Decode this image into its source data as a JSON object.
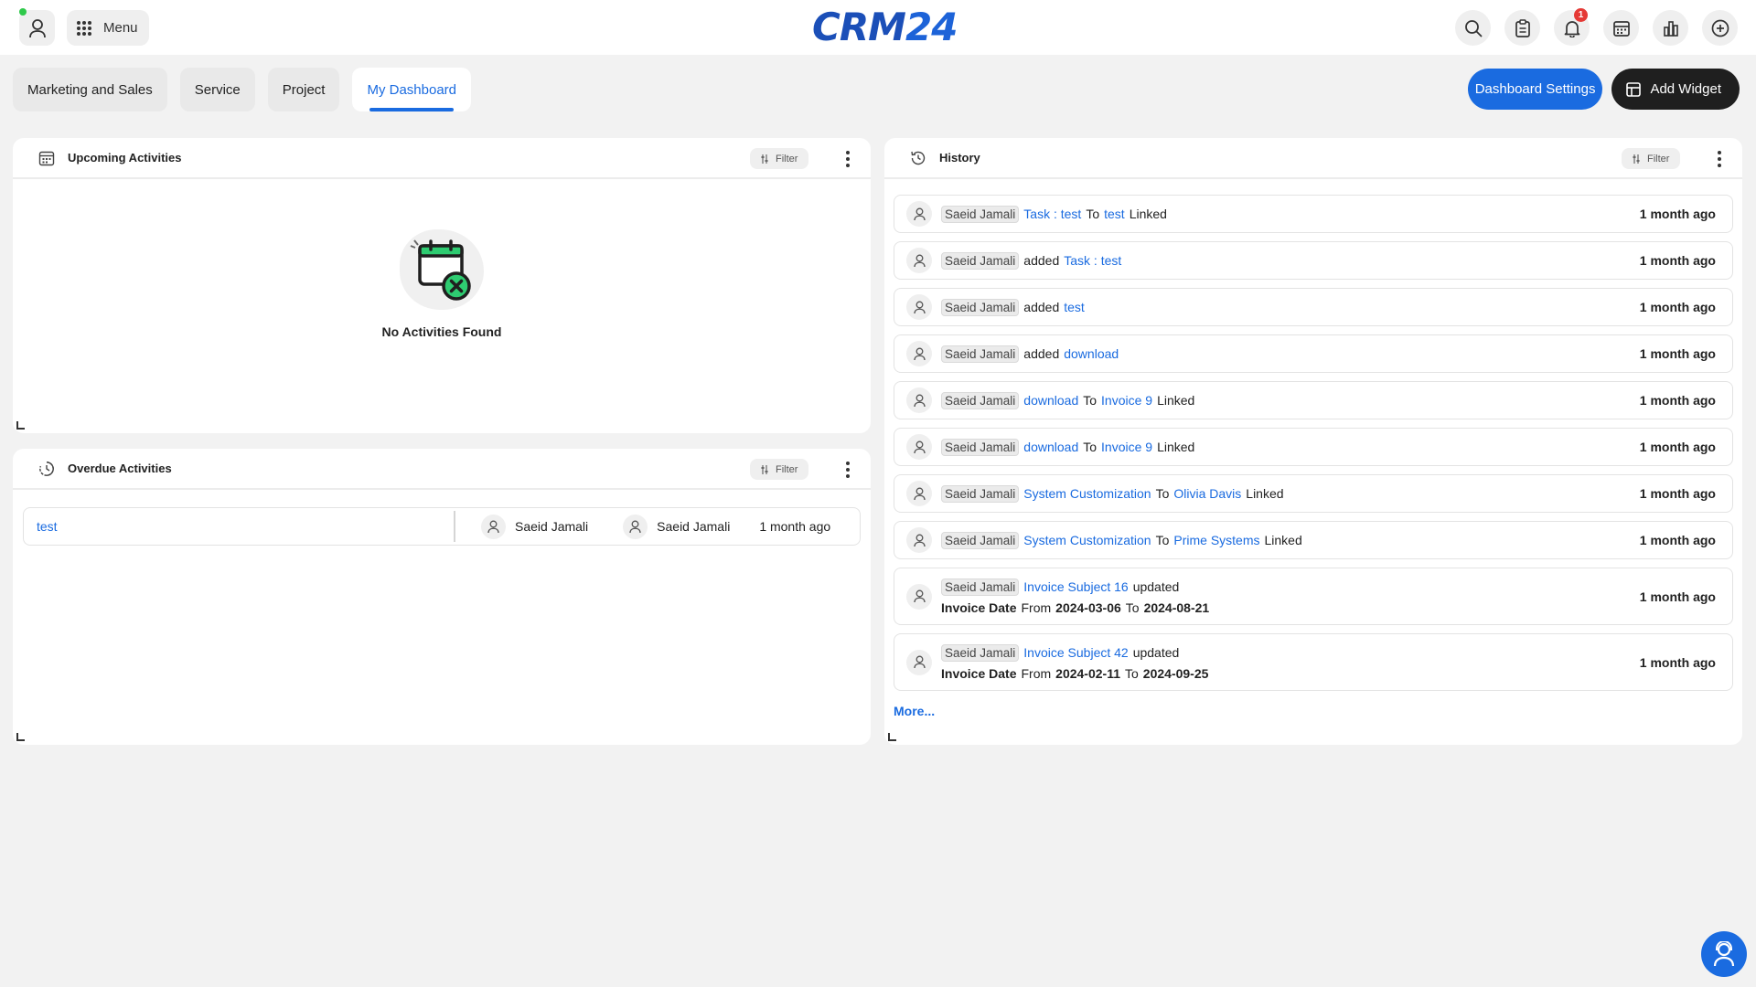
{
  "header": {
    "menu_label": "Menu",
    "logo_text_a": "CRM",
    "logo_text_b": "24",
    "notification_count": "1",
    "icons": [
      "search-icon",
      "clipboard-icon",
      "bell-icon",
      "calendar-icon",
      "chart-icon",
      "plus-circle-icon"
    ]
  },
  "tabs": [
    {
      "label": "Marketing and Sales",
      "active": false
    },
    {
      "label": "Service",
      "active": false
    },
    {
      "label": "Project",
      "active": false
    },
    {
      "label": "My Dashboard",
      "active": true
    }
  ],
  "actions": {
    "settings_label": "Dashboard Settings",
    "add_widget_label": "Add Widget"
  },
  "upcoming": {
    "title": "Upcoming Activities",
    "filter_label": "Filter",
    "empty_text": "No Activities Found"
  },
  "overdue": {
    "title": "Overdue Activities",
    "filter_label": "Filter",
    "row": {
      "subject": "test",
      "assigned_by": "Saeid Jamali",
      "assigned_to": "Saeid Jamali",
      "time": "1 month ago"
    }
  },
  "history": {
    "title": "History",
    "filter_label": "Filter",
    "more_label": "More...",
    "rows": [
      {
        "user": "Saeid Jamali",
        "line1": [
          {
            "t": "Task : test",
            "k": "link"
          },
          {
            "t": "To",
            "k": "text"
          },
          {
            "t": "test",
            "k": "link"
          },
          {
            "t": "Linked",
            "k": "text"
          }
        ],
        "time": "1 month ago"
      },
      {
        "user": "Saeid Jamali",
        "line1": [
          {
            "t": "added",
            "k": "text"
          },
          {
            "t": "Task : test",
            "k": "link"
          }
        ],
        "time": "1 month ago"
      },
      {
        "user": "Saeid Jamali",
        "line1": [
          {
            "t": "added",
            "k": "text"
          },
          {
            "t": "test",
            "k": "link"
          }
        ],
        "time": "1 month ago"
      },
      {
        "user": "Saeid Jamali",
        "line1": [
          {
            "t": "added",
            "k": "text"
          },
          {
            "t": "download",
            "k": "link"
          }
        ],
        "time": "1 month ago"
      },
      {
        "user": "Saeid Jamali",
        "line1": [
          {
            "t": "download",
            "k": "link"
          },
          {
            "t": "To",
            "k": "text"
          },
          {
            "t": "Invoice 9",
            "k": "link"
          },
          {
            "t": "Linked",
            "k": "text"
          }
        ],
        "time": "1 month ago"
      },
      {
        "user": "Saeid Jamali",
        "line1": [
          {
            "t": "download",
            "k": "link"
          },
          {
            "t": "To",
            "k": "text"
          },
          {
            "t": "Invoice 9",
            "k": "link"
          },
          {
            "t": "Linked",
            "k": "text"
          }
        ],
        "time": "1 month ago"
      },
      {
        "user": "Saeid Jamali",
        "line1": [
          {
            "t": "System Customization",
            "k": "link"
          },
          {
            "t": "To",
            "k": "text"
          },
          {
            "t": "Olivia Davis",
            "k": "link"
          },
          {
            "t": "Linked",
            "k": "text"
          }
        ],
        "time": "1 month ago"
      },
      {
        "user": "Saeid Jamali",
        "line1": [
          {
            "t": "System Customization",
            "k": "link"
          },
          {
            "t": "To",
            "k": "text"
          },
          {
            "t": "Prime Systems",
            "k": "link"
          },
          {
            "t": "Linked",
            "k": "text"
          }
        ],
        "time": "1 month ago"
      },
      {
        "user": "Saeid Jamali",
        "line1": [
          {
            "t": "Invoice Subject 16",
            "k": "link"
          },
          {
            "t": "updated",
            "k": "text"
          }
        ],
        "line2": [
          {
            "t": "Invoice Date",
            "k": "bold"
          },
          {
            "t": "From",
            "k": "text"
          },
          {
            "t": "2024-03-06",
            "k": "bold"
          },
          {
            "t": "To",
            "k": "text"
          },
          {
            "t": "2024-08-21",
            "k": "bold"
          }
        ],
        "time": "1 month ago"
      },
      {
        "user": "Saeid Jamali",
        "line1": [
          {
            "t": "Invoice Subject 42",
            "k": "link"
          },
          {
            "t": "updated",
            "k": "text"
          }
        ],
        "line2": [
          {
            "t": "Invoice Date",
            "k": "bold"
          },
          {
            "t": "From",
            "k": "text"
          },
          {
            "t": "2024-02-11",
            "k": "bold"
          },
          {
            "t": "To",
            "k": "text"
          },
          {
            "t": "2024-09-25",
            "k": "bold"
          }
        ],
        "time": "1 month ago"
      }
    ]
  },
  "colors": {
    "accent": "#1a6be0",
    "dark_button": "#1f1f1f",
    "online": "#2ec94a",
    "badge": "#e53935",
    "empty_icon_green": "#2ecc71"
  }
}
